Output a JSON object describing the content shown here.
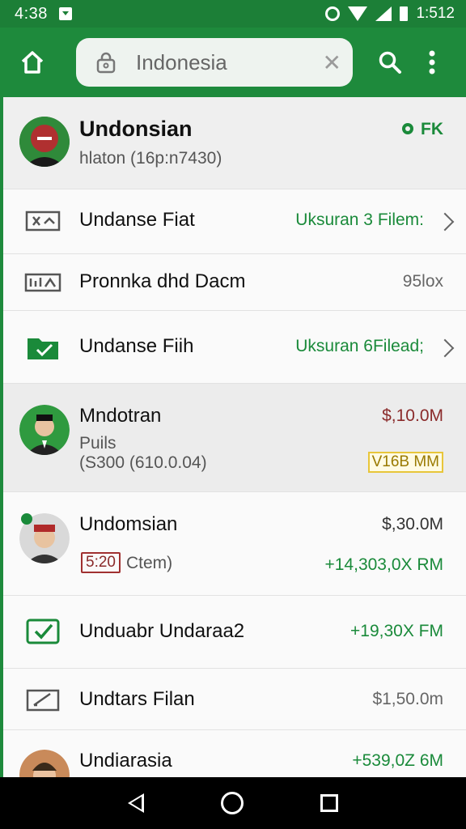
{
  "status_bar": {
    "time": "4:38",
    "clock_right": "1:512"
  },
  "search": {
    "value": "Indonesia",
    "clear_label": "✕"
  },
  "list": [
    {
      "title": "Undonsian",
      "subtitle": "hlaton (16p:n7430)",
      "right": "FK"
    },
    {
      "title": "Undanse Fiat",
      "right": "Uksuran 3 Filem:"
    },
    {
      "title": "Pronnka dhd Dacm",
      "right": "95lox"
    },
    {
      "title": "Undanse Fiih",
      "right": "Uksuran 6Filead;"
    },
    {
      "title": "Mndotran",
      "line2": "Puils",
      "line3": "(S300 (610.0.04)",
      "right": "$,10.0M",
      "right2": "V16B MM"
    },
    {
      "title": "Undomsian",
      "tag": "5:20",
      "tag_text": "Ctem)",
      "right": "$,30.0M",
      "right2": "+14,303,0X RM"
    },
    {
      "title": "Unduabr Undaraa2",
      "right": "+19,30X FM"
    },
    {
      "title": "Undtars Filan",
      "right": "$1,50.0m"
    },
    {
      "title": "Undiarasia",
      "right": "+539,0Z 6M"
    }
  ],
  "colors": {
    "primary": "#1e8a3c",
    "status": "#1c7f37",
    "accent_green": "#1a8a3a",
    "maroon": "#8a2a2a"
  }
}
